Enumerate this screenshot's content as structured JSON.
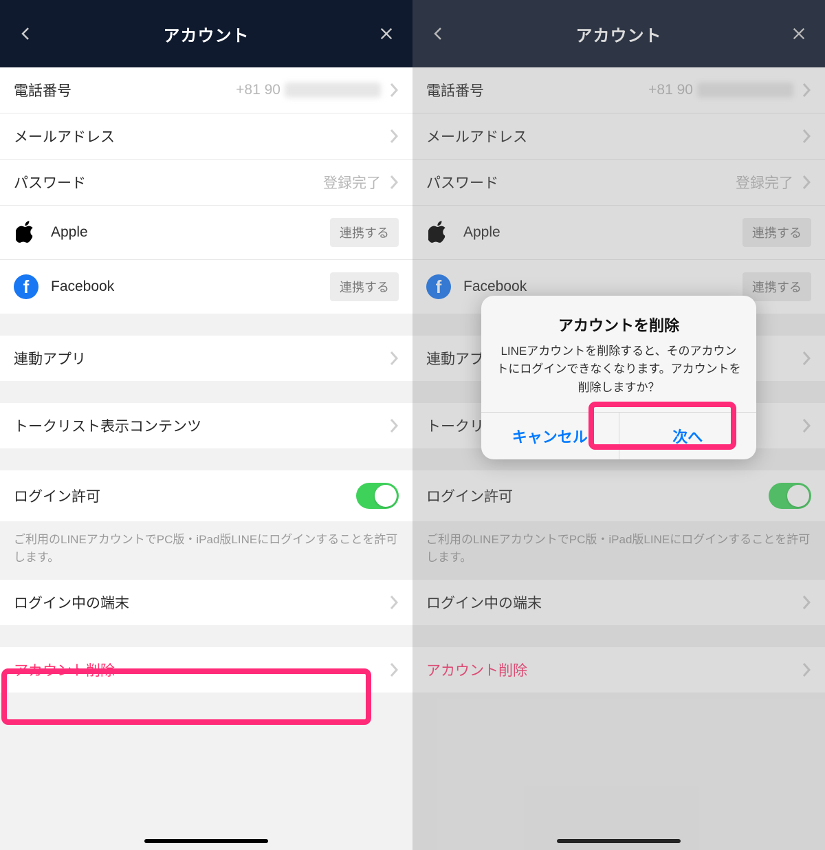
{
  "header": {
    "title": "アカウント"
  },
  "rows": {
    "phone": {
      "label": "電話番号",
      "value": "+81 90"
    },
    "email": {
      "label": "メールアドレス"
    },
    "password": {
      "label": "パスワード",
      "value": "登録完了"
    },
    "apple": {
      "label": "Apple",
      "button": "連携する"
    },
    "facebook": {
      "label": "Facebook",
      "button": "連携する"
    },
    "linked_apps": {
      "label": "連動アプリ"
    },
    "talklist": {
      "label": "トークリスト表示コンテンツ"
    },
    "login_allow": {
      "label": "ログイン許可"
    },
    "logged_in_devices": {
      "label": "ログイン中の端末"
    },
    "delete_account": {
      "label": "アカウント削除"
    }
  },
  "footnote": "ご利用のLINEアカウントでPC版・iPad版LINEにログインすることを許可します。",
  "alert": {
    "title": "アカウントを削除",
    "message": "LINEアカウントを削除すると、そのアカウントにログインできなくなります。アカウントを削除しますか？",
    "cancel": "キャンセル",
    "next": "次へ"
  }
}
